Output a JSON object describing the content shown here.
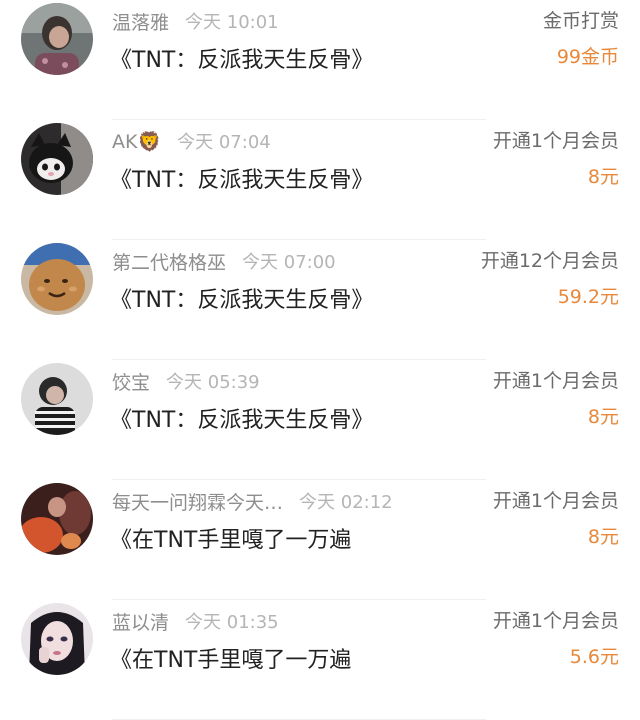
{
  "rewards": [
    {
      "name": "温落雅",
      "time": "今天 10:01",
      "book": "《TNT：反派我天生反骨》",
      "gift": "金币打赏",
      "amount": "99金币"
    },
    {
      "name": "AK🦁",
      "time": "今天 07:04",
      "book": "《TNT：反派我天生反骨》",
      "gift": "开通1个月会员",
      "amount": "8元"
    },
    {
      "name": "第二代格格巫",
      "time": "今天 07:00",
      "book": "《TNT：反派我天生反骨》",
      "gift": "开通12个月会员",
      "amount": "59.2元"
    },
    {
      "name": "饺宝",
      "time": "今天 05:39",
      "book": "《TNT：反派我天生反骨》",
      "gift": "开通1个月会员",
      "amount": "8元"
    },
    {
      "name": "每天一问翔霖今天…",
      "time": "今天 02:12",
      "book": "《在TNT手里嘎了一万遍",
      "gift": "开通1个月会员",
      "amount": "8元"
    },
    {
      "name": "蓝以清",
      "time": "今天 01:35",
      "book": "《在TNT手里嘎了一万遍",
      "gift": "开通1个月会员",
      "amount": "5.6元"
    }
  ],
  "colors": {
    "amount": "#e8883a",
    "name": "#8e8e8e",
    "time": "#b5b5b5",
    "title": "#222222"
  }
}
